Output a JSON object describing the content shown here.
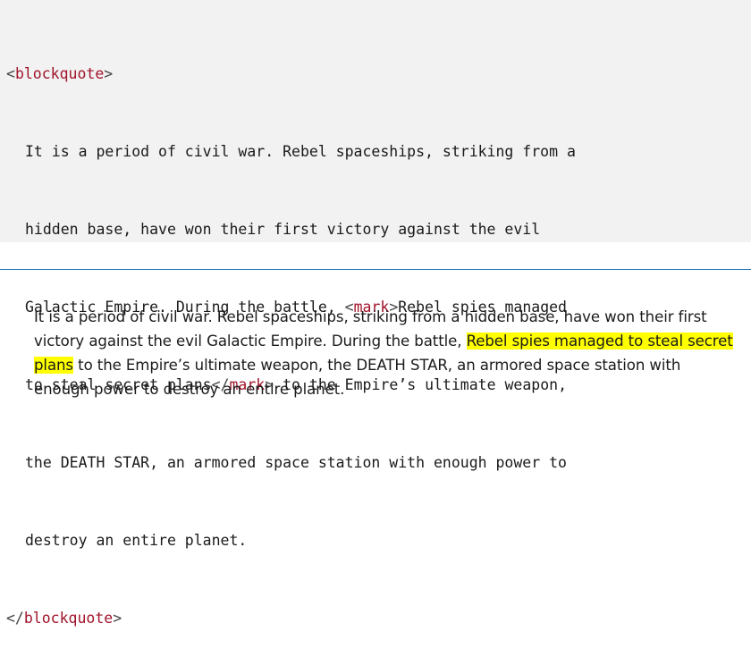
{
  "code": {
    "open_tag": {
      "lt": "<",
      "name": "blockquote",
      "gt": ">"
    },
    "close_tag": {
      "lt": "</",
      "name": "blockquote",
      "gt": ">"
    },
    "lines": [
      "It is a period of civil war. Rebel spaceships, striking from a",
      "hidden base, have won their first victory against the evil",
      {
        "before": "Galactic Empire. During the battle, ",
        "mark_open_lt": "<",
        "mark_open_name": "mark",
        "mark_open_gt": ">",
        "after": "Rebel spies managed"
      },
      {
        "before": "to steal secret plans",
        "mark_close_lt": "</",
        "mark_close_name": "mark",
        "mark_close_gt": ">",
        "after": " to the Empire’s ultimate weapon,"
      },
      "the DEATH STAR, an armored space station with enough power to",
      "destroy an entire planet."
    ]
  },
  "preview": {
    "before": "It is a period of civil war. Rebel spaceships, striking from a hidden base, have won their first victory against the evil Galactic Empire. During the battle, ",
    "highlight": "Rebel spies managed to steal secret plans",
    "after": " to the Empire’s ultimate weapon, the DEATH STAR, an armored space station with enough power to destroy an entire planet.",
    "highlight_color": "#ffff00"
  },
  "colors": {
    "code_background": "#f2f2f2",
    "tag_name": "#a0142a",
    "divider": "#2c7ab8"
  }
}
